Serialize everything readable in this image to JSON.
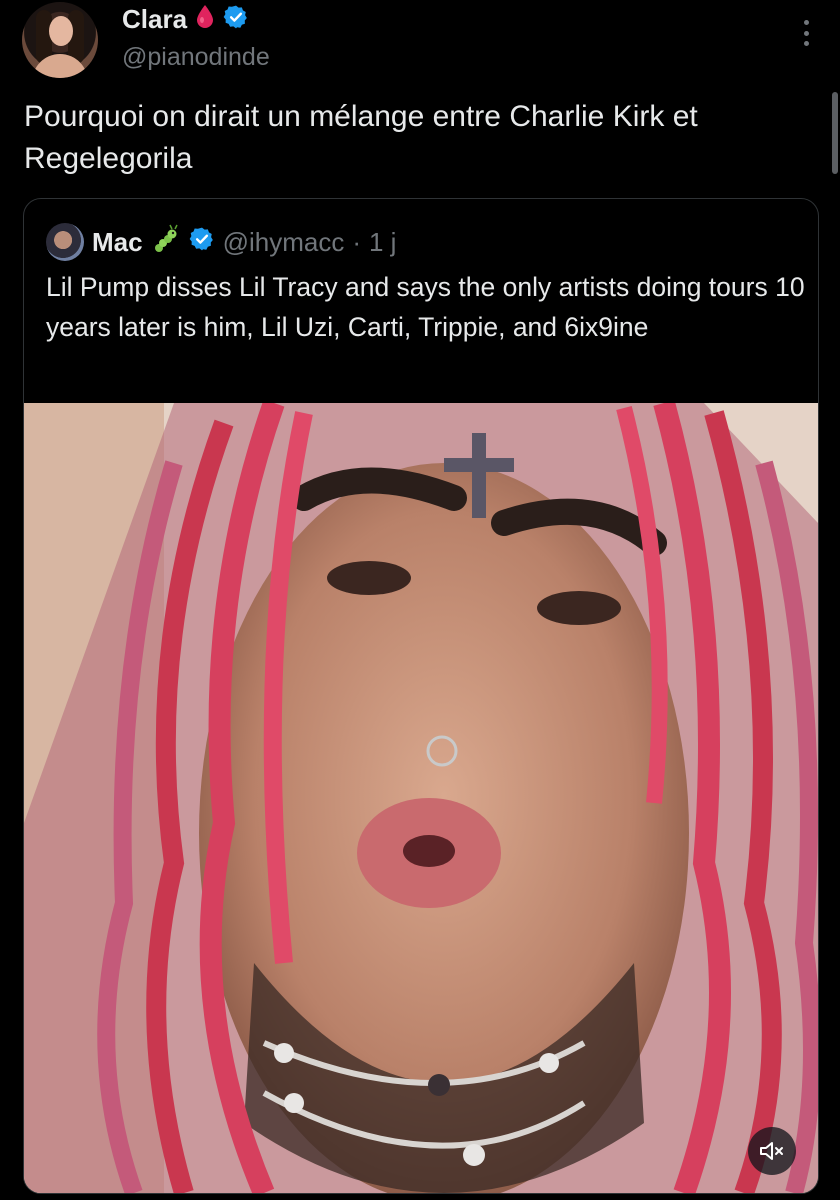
{
  "author": {
    "display_name": "Clara",
    "handle": "@pianodinde",
    "emoji_badge": "blood-drop-icon",
    "verified_badge": "verified-badge-icon"
  },
  "tweet": {
    "text": "Pourquoi on dirait un mélange entre Charlie Kirk et Regelegorila"
  },
  "quoted": {
    "display_name": "Mac",
    "emoji_badge": "caterpillar-icon",
    "verified_badge": "verified-badge-icon",
    "handle": "@ihymacc",
    "separator": "·",
    "time": "1 j",
    "text": "Lil Pump disses Lil Tracy and says the only artists doing tours 10 years later is him, Lil Uzi, Carti, Trippie, and 6ix9ine"
  },
  "media": {
    "type": "video",
    "muted_icon": "volume-muted-icon"
  },
  "colors": {
    "background": "#000000",
    "text_primary": "#e7e9ea",
    "text_secondary": "#71767b",
    "border": "#2f3336",
    "verified_blue": "#1d9bf0",
    "blood_red": "#e0245e"
  }
}
